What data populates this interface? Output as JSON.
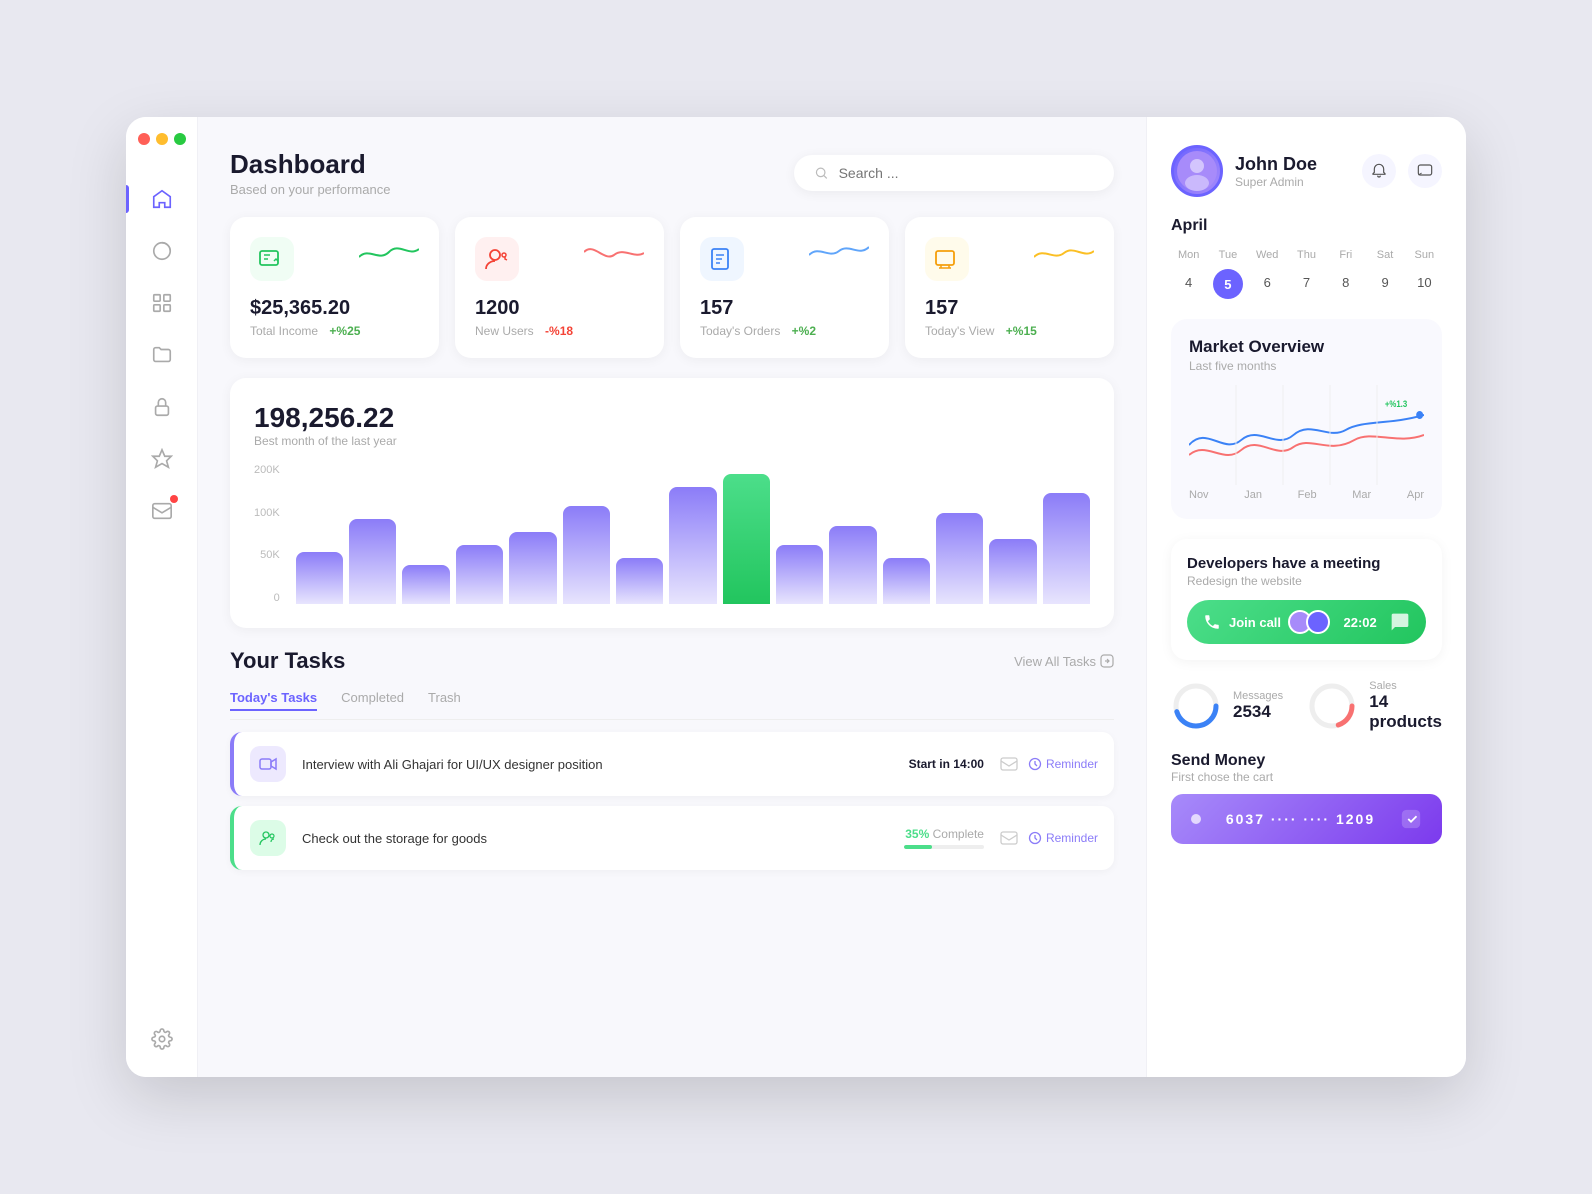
{
  "window": {
    "controls": [
      "red",
      "yellow",
      "green"
    ]
  },
  "sidebar": {
    "items": [
      {
        "name": "home",
        "icon": "🏠",
        "active": true
      },
      {
        "name": "chart",
        "icon": "◑",
        "active": false
      },
      {
        "name": "grid",
        "icon": "⊞",
        "active": false
      },
      {
        "name": "folder",
        "icon": "📁",
        "active": false
      },
      {
        "name": "lock",
        "icon": "🔒",
        "active": false
      },
      {
        "name": "star",
        "icon": "☆",
        "active": false
      },
      {
        "name": "mail",
        "icon": "✉",
        "active": false,
        "badge": true
      },
      {
        "name": "settings",
        "icon": "⚙",
        "active": false
      }
    ]
  },
  "header": {
    "title": "Dashboard",
    "subtitle": "Based on your performance",
    "search_placeholder": "Search ..."
  },
  "stats": [
    {
      "value": "$25,365.20",
      "label": "Total Income",
      "change": "+%25",
      "direction": "up",
      "color": "#22c55e",
      "icon": "💳"
    },
    {
      "value": "1200",
      "label": "New Users",
      "change": "-%18",
      "direction": "down",
      "color": "#f44336",
      "icon": "👤"
    },
    {
      "value": "157",
      "label": "Today's Orders",
      "change": "+%2",
      "direction": "up",
      "color": "#3b82f6",
      "icon": "📋"
    },
    {
      "value": "157",
      "label": "Today's View",
      "change": "+%15",
      "direction": "up",
      "color": "#f59e0b",
      "icon": "🖥"
    }
  ],
  "chart": {
    "main_value": "198,256.22",
    "subtitle": "Best month of the last year",
    "y_labels": [
      "200K",
      "100K",
      "50K",
      "0"
    ],
    "bars": [
      40,
      65,
      30,
      45,
      55,
      75,
      35,
      90,
      100,
      45,
      60,
      35,
      70,
      50,
      85
    ],
    "highlight_index": 8
  },
  "tasks": {
    "title": "Your Tasks",
    "tabs": [
      "Today's Tasks",
      "Completed",
      "Trash"
    ],
    "active_tab": 0,
    "view_all": "View All Tasks",
    "items": [
      {
        "name": "Interview with Ali Ghajari for UI/UX designer position",
        "time_label": "Start in",
        "time_value": "14:00",
        "icon": "🎥",
        "icon_bg": "#ede9fe",
        "border_color": "#8b7cf8",
        "progress": null,
        "has_reminder": true
      },
      {
        "name": "Check out the storage for goods",
        "time_label": null,
        "time_value": null,
        "icon": "👥",
        "icon_bg": "#dcfce7",
        "border_color": "#4cde8a",
        "progress": 35,
        "has_reminder": true
      }
    ]
  },
  "right_panel": {
    "profile": {
      "name": "John Doe",
      "role": "Super Admin"
    },
    "calendar": {
      "month": "April",
      "days": [
        {
          "label": "Mon",
          "header": true
        },
        {
          "label": "Tue",
          "header": true
        },
        {
          "label": "Wed",
          "header": true
        },
        {
          "label": "Thu",
          "header": true
        },
        {
          "label": "Fri",
          "header": true
        },
        {
          "label": "Sat",
          "header": true
        },
        {
          "label": "Sun",
          "header": true
        },
        {
          "label": "4"
        },
        {
          "label": "5",
          "active": true
        },
        {
          "label": "6"
        },
        {
          "label": "7"
        },
        {
          "label": "8"
        },
        {
          "label": "9"
        },
        {
          "label": "10"
        }
      ]
    },
    "market_overview": {
      "title": "Market  Overview",
      "subtitle": "Last five months",
      "badge": "+%1.3",
      "x_labels": [
        "Nov",
        "Jan",
        "Feb",
        "Mar",
        "Apr"
      ]
    },
    "meeting": {
      "title": "Developers have a meeting",
      "subtitle": "Redesign the website",
      "join_label": "Join call",
      "time": "22:02"
    },
    "messages": {
      "label": "Messages",
      "value": "2534",
      "percent": 70
    },
    "sales": {
      "label": "Sales",
      "value": "14 products",
      "percent": 45
    },
    "send_money": {
      "title": "Send Money",
      "subtitle": "First chose the cart",
      "card_number": "6037 ···· ···· 1209"
    }
  }
}
